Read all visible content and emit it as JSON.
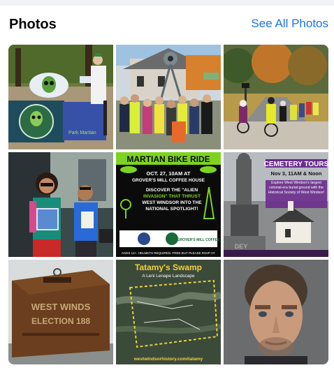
{
  "section": {
    "title": "Photos",
    "see_all_label": "See All Photos"
  },
  "photos": [
    {
      "id": "p1",
      "alt": "Green alien mascot at an outdoor booth with alien banners",
      "banner_text": "Park Martian"
    },
    {
      "id": "p2",
      "alt": "Group of people posing under a tall alien tripod sculpture"
    },
    {
      "id": "p3",
      "alt": "Cyclists riding along an autumn road"
    },
    {
      "id": "p4",
      "alt": "Woman and boy holding flyers in front of a cafe"
    },
    {
      "id": "p5",
      "alt": "Martian Bike Ride event poster",
      "title": "MARTIAN BIKE RIDE",
      "date": "OCT. 27, 10AM AT",
      "venue": "GROVER'S MILL COFFEE HOUSE",
      "line1": "DISCOVER THE \"ALIEN",
      "line2": "INVASION\" THAT THRUST",
      "line3": "WEST WINDSOR INTO THE",
      "line4": "NATIONAL SPOTLIGHT!",
      "footer": "AGES 12+. HELMETS REQUIRED. FREE BUT PLEASE RSVP AT:",
      "sponsor": "GROVER'S MILL COFFEE"
    },
    {
      "id": "p6",
      "alt": "Cemetery tours event poster",
      "title": "CEMETERY TOURS",
      "when": "Nov 3, 11AM & Noon",
      "body": "Explore West Windsor's largest colonial-era burial ground with the Historical Society of West Windsor!"
    },
    {
      "id": "p7",
      "alt": "Antique wooden ballot box",
      "box_text_1": "WEST WINDS",
      "box_text_2": "ELECTION 188"
    },
    {
      "id": "p8",
      "alt": "Map of Tatamy's Swamp",
      "title": "Tatamy's Swamp",
      "subtitle": "A Leni Lenape Landscape",
      "url": "westwindsorhistory.com/tatamy"
    },
    {
      "id": "p9",
      "alt": "Portrait photo of a man"
    }
  ],
  "colors": {
    "link": "#1b74e4",
    "title": "#050505",
    "card": "#ffffff",
    "page_bg": "#f0f2f5",
    "poster_green": "#7ed321",
    "poster_purple": "#6a2c8c"
  }
}
